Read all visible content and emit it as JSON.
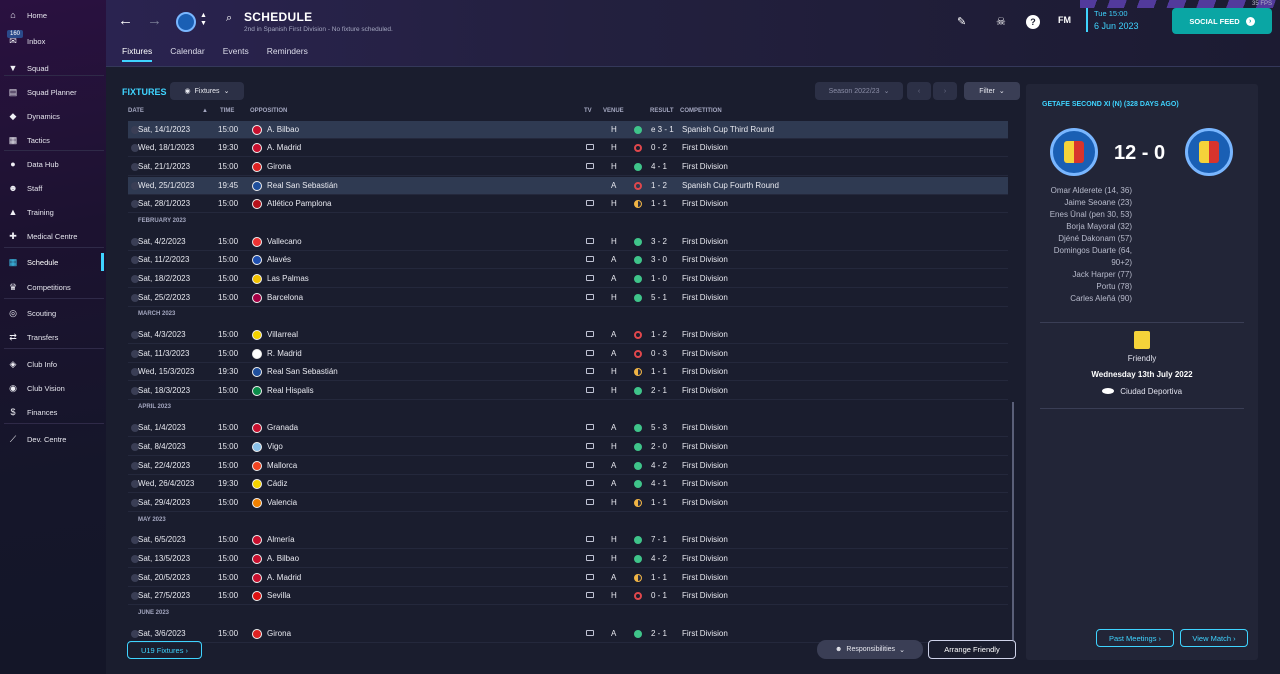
{
  "app": {
    "fps": "35 FPS"
  },
  "sidebar": {
    "inbox_badge": "160",
    "items": [
      {
        "label": "Home",
        "icon": "home-icon",
        "glyph": "⌂"
      },
      {
        "label": "Inbox",
        "icon": "inbox-icon",
        "glyph": "✉"
      },
      {
        "label": "Squad",
        "icon": "shirt-icon",
        "glyph": "▼"
      },
      {
        "label": "Squad Planner",
        "icon": "clipboard-icon",
        "glyph": "▤"
      },
      {
        "label": "Dynamics",
        "icon": "handshake-icon",
        "glyph": "◆"
      },
      {
        "label": "Tactics",
        "icon": "tactics-icon",
        "glyph": "▦"
      },
      {
        "label": "Data Hub",
        "icon": "data-hub-icon",
        "glyph": "●"
      },
      {
        "label": "Staff",
        "icon": "staff-icon",
        "glyph": "☻"
      },
      {
        "label": "Training",
        "icon": "training-icon",
        "glyph": "▲"
      },
      {
        "label": "Medical Centre",
        "icon": "medical-icon",
        "glyph": "✚"
      },
      {
        "label": "Schedule",
        "icon": "calendar-icon",
        "glyph": "▦"
      },
      {
        "label": "Competitions",
        "icon": "trophy-icon",
        "glyph": "♛"
      },
      {
        "label": "Scouting",
        "icon": "binoculars-icon",
        "glyph": "◎"
      },
      {
        "label": "Transfers",
        "icon": "transfers-icon",
        "glyph": "⇄"
      },
      {
        "label": "Club Info",
        "icon": "shield-icon",
        "glyph": "◈"
      },
      {
        "label": "Club Vision",
        "icon": "vision-icon",
        "glyph": "◉"
      },
      {
        "label": "Finances",
        "icon": "finances-icon",
        "glyph": "$"
      },
      {
        "label": "Dev. Centre",
        "icon": "dev-centre-icon",
        "glyph": "⟋"
      }
    ]
  },
  "header": {
    "title": "SCHEDULE",
    "subtitle": "2nd in Spanish First Division - No fixture scheduled.",
    "tabs": [
      "Fixtures",
      "Calendar",
      "Events",
      "Reminders"
    ],
    "date_time": "Tue 15:00",
    "date": "6 Jun 2023",
    "fm_label": "FM",
    "social_feed": "SOCIAL FEED"
  },
  "fixtures": {
    "title": "FIXTURES",
    "view_label": "Fixtures",
    "season": "Season 2022/23",
    "filter_label": "Filter",
    "columns": {
      "date": "DATE",
      "time": "TIME",
      "opposition": "OPPOSITION",
      "tv": "TV",
      "venue": "VENUE",
      "result": "RESULT",
      "competition": "COMPETITION"
    },
    "months": [
      "FEBRUARY 2023",
      "MARCH 2023",
      "APRIL 2023",
      "MAY 2023",
      "JUNE 2023"
    ],
    "rows": [
      {
        "date": "Sat, 14/1/2023",
        "time": "15:00",
        "opp": "A. Bilbao",
        "tv": false,
        "venue": "H",
        "outcome": "win",
        "result": "e 3 - 1",
        "comp": "Spanish Cup Third Round",
        "hl": true
      },
      {
        "date": "Wed, 18/1/2023",
        "time": "19:30",
        "opp": "A. Madrid",
        "tv": true,
        "venue": "H",
        "outcome": "loss",
        "result": "0 - 2",
        "comp": "First Division",
        "hl": false
      },
      {
        "date": "Sat, 21/1/2023",
        "time": "15:00",
        "opp": "Girona",
        "tv": true,
        "venue": "H",
        "outcome": "win",
        "result": "4 - 1",
        "comp": "First Division",
        "hl": false
      },
      {
        "date": "Wed, 25/1/2023",
        "time": "19:45",
        "opp": "Real San Sebastián",
        "tv": false,
        "venue": "A",
        "outcome": "loss",
        "result": "1 - 2",
        "comp": "Spanish Cup Fourth Round",
        "hl": true
      },
      {
        "date": "Sat, 28/1/2023",
        "time": "15:00",
        "opp": "Atlético Pamplona",
        "tv": true,
        "venue": "H",
        "outcome": "draw",
        "result": "1 - 1",
        "comp": "First Division",
        "hl": false
      },
      {
        "date": "Sat, 4/2/2023",
        "time": "15:00",
        "opp": "Vallecano",
        "tv": true,
        "venue": "H",
        "outcome": "win",
        "result": "3 - 2",
        "comp": "First Division",
        "hl": false
      },
      {
        "date": "Sat, 11/2/2023",
        "time": "15:00",
        "opp": "Alavés",
        "tv": true,
        "venue": "A",
        "outcome": "win",
        "result": "3 - 0",
        "comp": "First Division",
        "hl": false
      },
      {
        "date": "Sat, 18/2/2023",
        "time": "15:00",
        "opp": "Las Palmas",
        "tv": true,
        "venue": "A",
        "outcome": "win",
        "result": "1 - 0",
        "comp": "First Division",
        "hl": false
      },
      {
        "date": "Sat, 25/2/2023",
        "time": "15:00",
        "opp": "Barcelona",
        "tv": true,
        "venue": "H",
        "outcome": "win",
        "result": "5 - 1",
        "comp": "First Division",
        "hl": false
      },
      {
        "date": "Sat, 4/3/2023",
        "time": "15:00",
        "opp": "Villarreal",
        "tv": true,
        "venue": "A",
        "outcome": "loss",
        "result": "1 - 2",
        "comp": "First Division",
        "hl": false
      },
      {
        "date": "Sat, 11/3/2023",
        "time": "15:00",
        "opp": "R. Madrid",
        "tv": true,
        "venue": "A",
        "outcome": "loss",
        "result": "0 - 3",
        "comp": "First Division",
        "hl": false
      },
      {
        "date": "Wed, 15/3/2023",
        "time": "19:30",
        "opp": "Real San Sebastián",
        "tv": true,
        "venue": "H",
        "outcome": "draw",
        "result": "1 - 1",
        "comp": "First Division",
        "hl": false
      },
      {
        "date": "Sat, 18/3/2023",
        "time": "15:00",
        "opp": "Real Hispalis",
        "tv": true,
        "venue": "H",
        "outcome": "win",
        "result": "2 - 1",
        "comp": "First Division",
        "hl": false
      },
      {
        "date": "Sat, 1/4/2023",
        "time": "15:00",
        "opp": "Granada",
        "tv": true,
        "venue": "A",
        "outcome": "win",
        "result": "5 - 3",
        "comp": "First Division",
        "hl": false
      },
      {
        "date": "Sat, 8/4/2023",
        "time": "15:00",
        "opp": "Vigo",
        "tv": true,
        "venue": "H",
        "outcome": "win",
        "result": "2 - 0",
        "comp": "First Division",
        "hl": false
      },
      {
        "date": "Sat, 22/4/2023",
        "time": "15:00",
        "opp": "Mallorca",
        "tv": true,
        "venue": "A",
        "outcome": "win",
        "result": "4 - 2",
        "comp": "First Division",
        "hl": false
      },
      {
        "date": "Wed, 26/4/2023",
        "time": "19:30",
        "opp": "Cádiz",
        "tv": true,
        "venue": "A",
        "outcome": "win",
        "result": "4 - 1",
        "comp": "First Division",
        "hl": false
      },
      {
        "date": "Sat, 29/4/2023",
        "time": "15:00",
        "opp": "Valencia",
        "tv": true,
        "venue": "H",
        "outcome": "draw",
        "result": "1 - 1",
        "comp": "First Division",
        "hl": false
      },
      {
        "date": "Sat, 6/5/2023",
        "time": "15:00",
        "opp": "Almería",
        "tv": true,
        "venue": "H",
        "outcome": "win",
        "result": "7 - 1",
        "comp": "First Division",
        "hl": false
      },
      {
        "date": "Sat, 13/5/2023",
        "time": "15:00",
        "opp": "A. Bilbao",
        "tv": true,
        "venue": "H",
        "outcome": "win",
        "result": "4 - 2",
        "comp": "First Division",
        "hl": false
      },
      {
        "date": "Sat, 20/5/2023",
        "time": "15:00",
        "opp": "A. Madrid",
        "tv": true,
        "venue": "A",
        "outcome": "draw",
        "result": "1 - 1",
        "comp": "First Division",
        "hl": false
      },
      {
        "date": "Sat, 27/5/2023",
        "time": "15:00",
        "opp": "Sevilla",
        "tv": true,
        "venue": "H",
        "outcome": "loss",
        "result": "0 - 1",
        "comp": "First Division",
        "hl": false
      },
      {
        "date": "Sat, 3/6/2023",
        "time": "15:00",
        "opp": "Girona",
        "tv": true,
        "venue": "A",
        "outcome": "win",
        "result": "2 - 1",
        "comp": "First Division",
        "hl": false
      }
    ],
    "u19_button": "U19 Fixtures",
    "responsibilities_button": "Responsibilities",
    "arrange_friendly_button": "Arrange Friendly"
  },
  "match_panel": {
    "title": "GETAFE SECOND XI (N) (328 DAYS AGO)",
    "score": "12 - 0",
    "scorers": [
      "Omar Alderete (14, 36)",
      "Jaime Seoane (23)",
      "Enes Ünal (pen 30, 53)",
      "Borja Mayoral (32)",
      "Djéné Dakonam (57)",
      "Domingos Duarte (64,",
      "90+2)",
      "Jack Harper (77)",
      "Portu (78)",
      "Carles Aleñá (90)"
    ],
    "competition": "Friendly",
    "match_date": "Wednesday 13th July 2022",
    "stadium": "Ciudad Deportiva",
    "past_meetings": "Past Meetings",
    "view_match": "View Match"
  }
}
